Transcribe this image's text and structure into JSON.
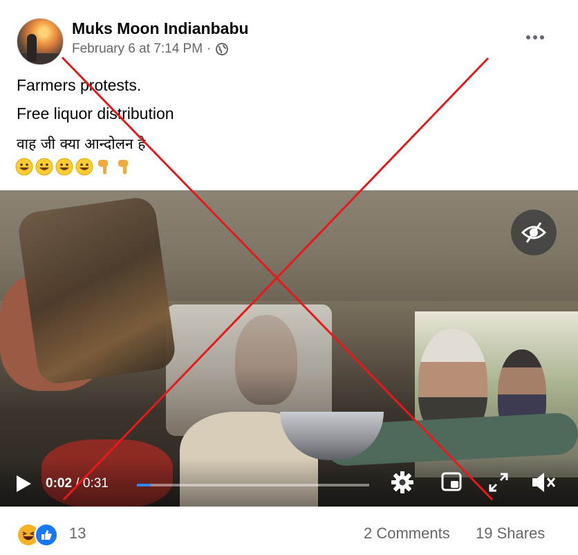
{
  "post": {
    "author": "Muks Moon Indianbabu",
    "date": "February 6 at 7:14 PM",
    "separator": "·",
    "privacy_icon": "globe-icon",
    "more_icon": "more-options-icon",
    "lines": [
      "Farmers protests.",
      "Free liquor distribution",
      "वाह जी क्या आन्दोलन है"
    ],
    "emojis": [
      "grinning-face-emoji",
      "grinning-face-emoji",
      "grinning-face-emoji",
      "grinning-face-emoji",
      "backhand-pointing-down-emoji",
      "backhand-pointing-down-emoji"
    ]
  },
  "video": {
    "current_time": "0:02",
    "duration_sep": " / ",
    "duration": "0:31",
    "progress_fraction": 0.06,
    "icons": [
      "play-icon",
      "settings-icon",
      "picture-in-picture-icon",
      "fullscreen-icon",
      "muted-icon",
      "hide-eye-icon"
    ]
  },
  "footer": {
    "reaction_icons": [
      "haha-reaction-icon",
      "like-reaction-icon"
    ],
    "reaction_count": "13",
    "comments": "2 Comments",
    "shares": "19 Shares"
  },
  "colors": {
    "overlay_cross": "#e8191a",
    "progress": "#2d88ff",
    "like_blue": "#1877f2",
    "meta_gray": "#65676b"
  }
}
